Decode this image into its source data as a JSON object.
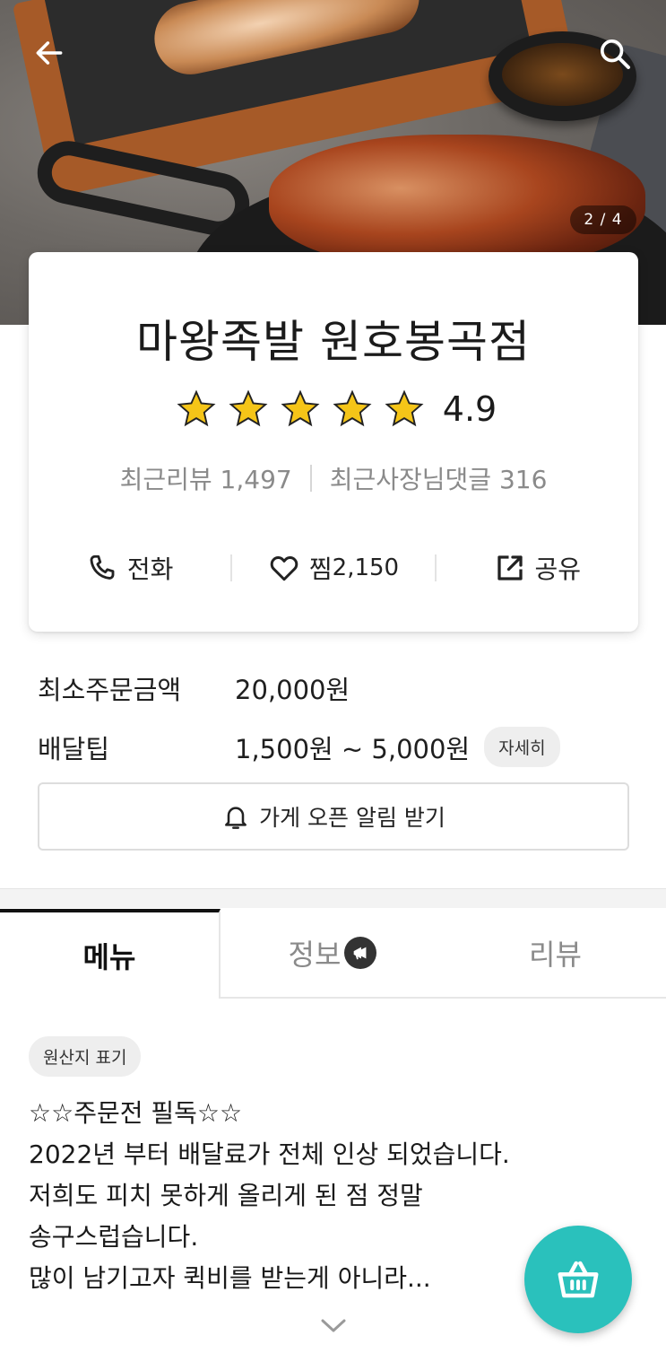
{
  "hero": {
    "page_current": "2",
    "page_total": "4",
    "page_indicator": "2 / 4"
  },
  "store": {
    "name": "마왕족발 원호봉곡점",
    "rating": "4.9",
    "rating_stars": 5,
    "recent_reviews": "최근리뷰 1,497",
    "recent_owner_replies": "최근사장님댓글 316"
  },
  "actions": {
    "call_label": "전화",
    "favorite_label": "찜",
    "favorite_count": "2,150",
    "share_label": "공유"
  },
  "info": {
    "min_order_label": "최소주문금액",
    "min_order_value": "20,000원",
    "delivery_tip_label": "배달팁",
    "delivery_tip_value": "1,500원 ~ 5,000원",
    "detail_label": "자세히"
  },
  "notify_label": "가게 오픈 알림 받기",
  "tabs": {
    "menu": "메뉴",
    "info": "정보",
    "review": "리뷰",
    "active": "menu"
  },
  "origin_label": "원산지 표기",
  "notice": {
    "line1": "☆☆주문전 필독☆☆",
    "line2": "2022년 부터 배달료가 전체 인상 되었습니다.",
    "line3": "저희도 피치 못하게 올리게 된 점 정말",
    "line4": "송구스럽습니다.",
    "line5": "많이 남기고자 퀵비를 받는게 아니라..."
  },
  "icons": {
    "back": "arrow-left-icon",
    "search": "search-icon",
    "star": "star-icon",
    "phone": "phone-icon",
    "heart": "heart-icon",
    "share": "share-icon",
    "bell": "bell-icon",
    "megaphone": "megaphone-icon",
    "chevron": "chevron-down-icon",
    "cart": "basket-icon"
  },
  "colors": {
    "accent": "#2ac1bc",
    "star": "#f5c518"
  }
}
